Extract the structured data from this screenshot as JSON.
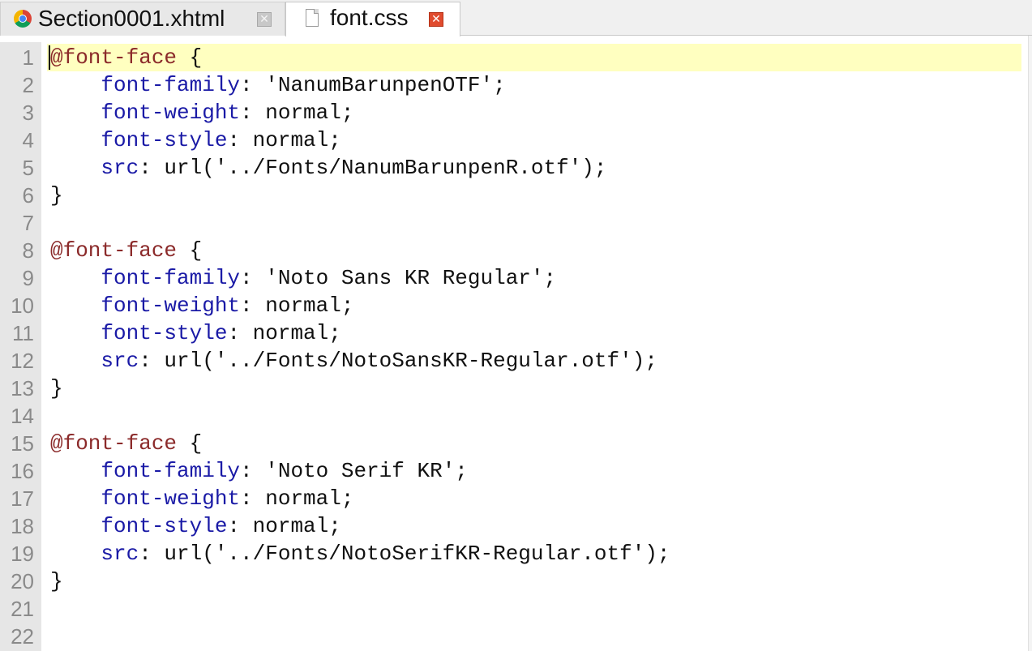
{
  "tabs": [
    {
      "title": "Section0001.xhtml",
      "icon": "chrome-icon",
      "active": false
    },
    {
      "title": "font.css",
      "icon": "file-icon",
      "active": true
    }
  ],
  "editor": {
    "lines": [
      {
        "n": "1",
        "segments": [
          {
            "t": "@font-face",
            "c": "at"
          },
          {
            "t": " {",
            "c": "pun"
          }
        ]
      },
      {
        "n": "2",
        "segments": [
          {
            "t": "    font-family",
            "c": "prop"
          },
          {
            "t": ": 'NanumBarunpenOTF';",
            "c": "pun"
          }
        ]
      },
      {
        "n": "3",
        "segments": [
          {
            "t": "    font-weight",
            "c": "prop"
          },
          {
            "t": ": normal;",
            "c": "pun"
          }
        ]
      },
      {
        "n": "4",
        "segments": [
          {
            "t": "    font-style",
            "c": "prop"
          },
          {
            "t": ": normal;",
            "c": "pun"
          }
        ]
      },
      {
        "n": "5",
        "segments": [
          {
            "t": "    src",
            "c": "prop"
          },
          {
            "t": ": url('../Fonts/NanumBarunpenR.otf');",
            "c": "pun"
          }
        ]
      },
      {
        "n": "6",
        "segments": [
          {
            "t": "}",
            "c": "pun"
          }
        ]
      },
      {
        "n": "7",
        "segments": []
      },
      {
        "n": "8",
        "segments": [
          {
            "t": "@font-face",
            "c": "at"
          },
          {
            "t": " {",
            "c": "pun"
          }
        ]
      },
      {
        "n": "9",
        "segments": [
          {
            "t": "    font-family",
            "c": "prop"
          },
          {
            "t": ": 'Noto Sans KR Regular';",
            "c": "pun"
          }
        ]
      },
      {
        "n": "10",
        "segments": [
          {
            "t": "    font-weight",
            "c": "prop"
          },
          {
            "t": ": normal;",
            "c": "pun"
          }
        ]
      },
      {
        "n": "11",
        "segments": [
          {
            "t": "    font-style",
            "c": "prop"
          },
          {
            "t": ": normal;",
            "c": "pun"
          }
        ]
      },
      {
        "n": "12",
        "segments": [
          {
            "t": "    src",
            "c": "prop"
          },
          {
            "t": ": url('../Fonts/NotoSansKR-Regular.otf');",
            "c": "pun"
          }
        ]
      },
      {
        "n": "13",
        "segments": [
          {
            "t": "}",
            "c": "pun"
          }
        ]
      },
      {
        "n": "14",
        "segments": []
      },
      {
        "n": "15",
        "segments": [
          {
            "t": "@font-face",
            "c": "at"
          },
          {
            "t": " {",
            "c": "pun"
          }
        ]
      },
      {
        "n": "16",
        "segments": [
          {
            "t": "    font-family",
            "c": "prop"
          },
          {
            "t": ": 'Noto Serif KR';",
            "c": "pun"
          }
        ]
      },
      {
        "n": "17",
        "segments": [
          {
            "t": "    font-weight",
            "c": "prop"
          },
          {
            "t": ": normal;",
            "c": "pun"
          }
        ]
      },
      {
        "n": "18",
        "segments": [
          {
            "t": "    font-style",
            "c": "prop"
          },
          {
            "t": ": normal;",
            "c": "pun"
          }
        ]
      },
      {
        "n": "19",
        "segments": [
          {
            "t": "    src",
            "c": "prop"
          },
          {
            "t": ": url('../Fonts/NotoSerifKR-Regular.otf');",
            "c": "pun"
          }
        ]
      },
      {
        "n": "20",
        "segments": [
          {
            "t": "}",
            "c": "pun"
          }
        ]
      },
      {
        "n": "21",
        "segments": []
      },
      {
        "n": "22",
        "segments": []
      }
    ]
  },
  "colors": {
    "at_rule": "#8b2a2a",
    "property": "#1a1aa6",
    "current_line_highlight": "#ffffc0",
    "gutter": "#e6e6e6",
    "active_tab_close": "#e04b2e"
  }
}
